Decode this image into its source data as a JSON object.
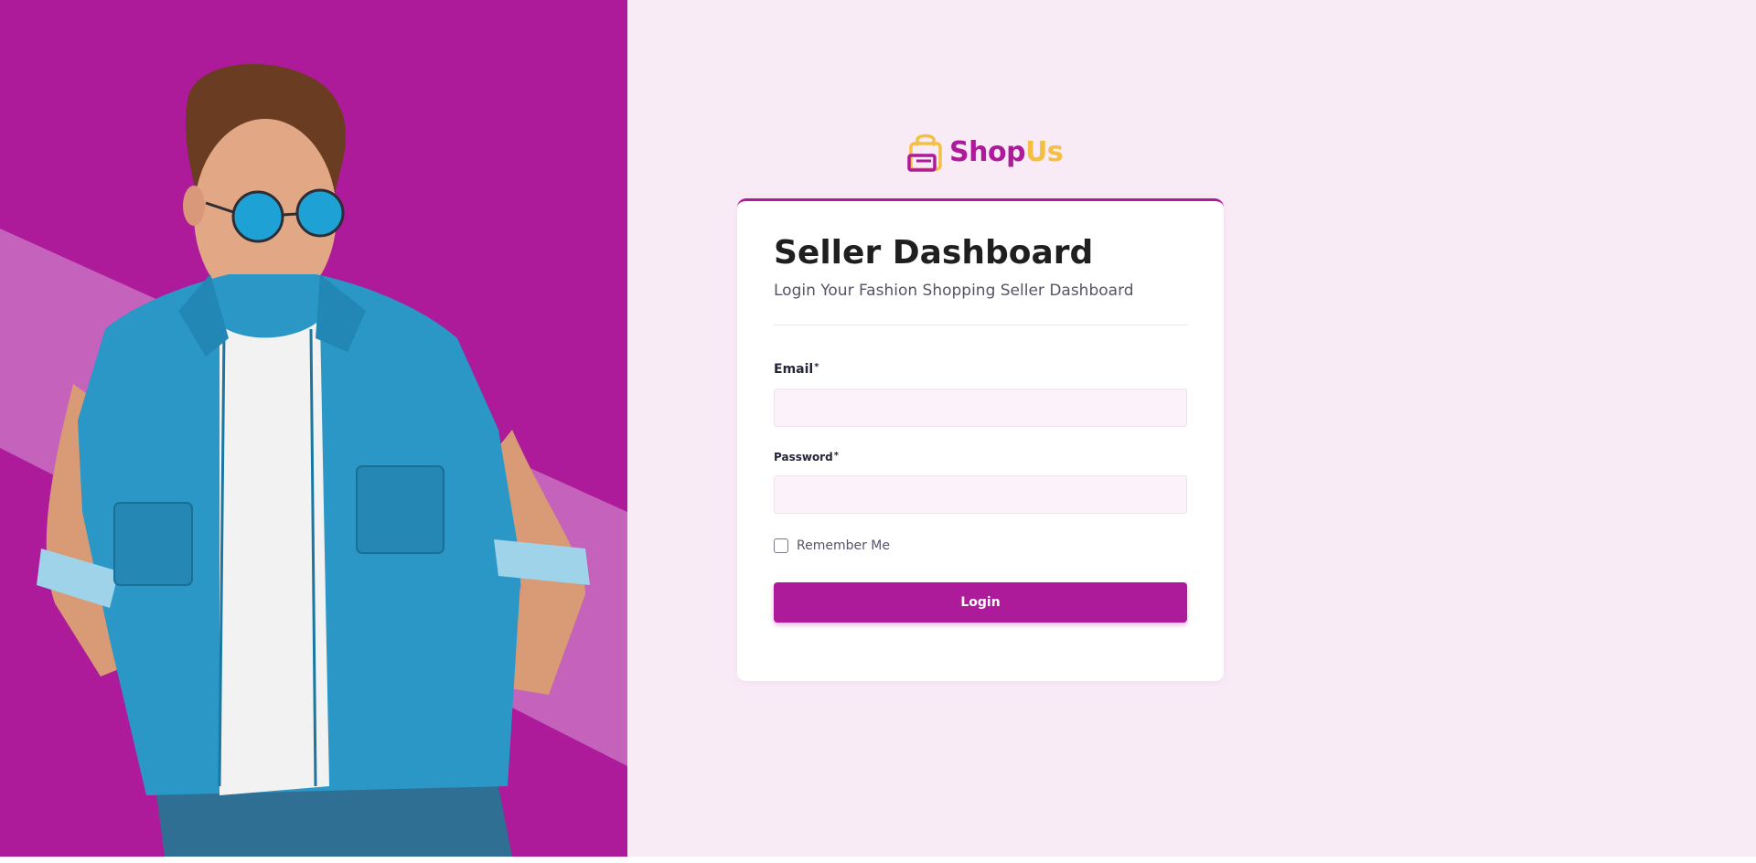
{
  "colors": {
    "brand_primary": "#ad1a9a",
    "brand_accent": "#f4c043",
    "page_background": "#f9ebf6",
    "hero_stripe": "#c562bb",
    "input_background": "#fcf2fa"
  },
  "hero": {
    "image_alt": "Man in denim shirt and sunglasses"
  },
  "logo": {
    "icon": "shopping-bag-icon",
    "text_part1": "Shop",
    "text_part2": "Us"
  },
  "card": {
    "title": "Seller Dashboard",
    "subtitle": "Login Your Fashion Shopping Seller Dashboard"
  },
  "form": {
    "email": {
      "label": "Email",
      "required_mark": "*",
      "value": "",
      "placeholder": ""
    },
    "password": {
      "label": "Password",
      "required_mark": "*",
      "value": "",
      "placeholder": ""
    },
    "remember": {
      "label": "Remember Me",
      "checked": false
    },
    "submit_label": "Login"
  }
}
